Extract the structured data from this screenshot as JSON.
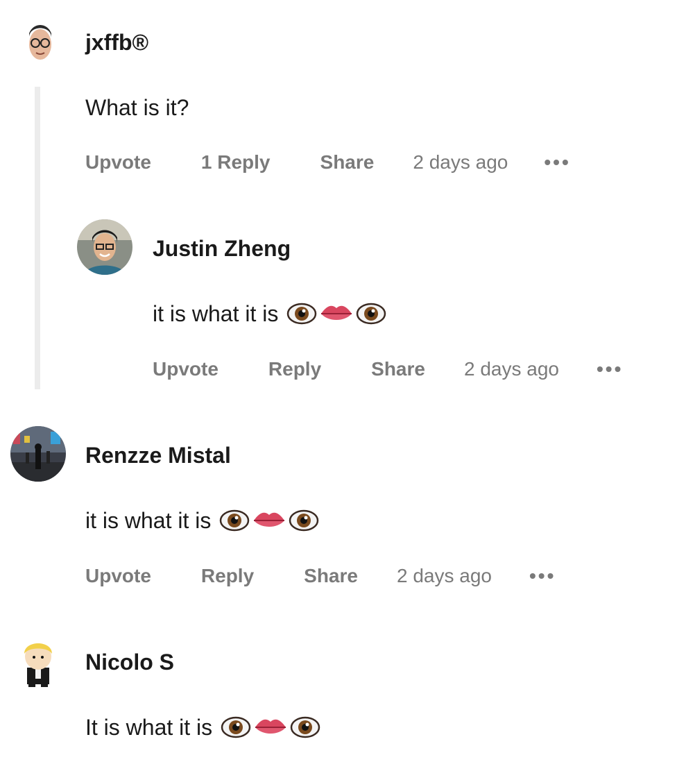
{
  "comments": [
    {
      "author": "jxffb®",
      "text": "What is it?",
      "actions": {
        "upvote": "Upvote",
        "reply": "1 Reply",
        "share": "Share",
        "time": "2 days ago",
        "more": "•••"
      },
      "emojis": []
    },
    {
      "author": "Justin Zheng",
      "text": "it is what it is",
      "actions": {
        "upvote": "Upvote",
        "reply": "Reply",
        "share": "Share",
        "time": "2 days ago",
        "more": "•••"
      },
      "emojis": [
        "eye-emoji",
        "lips-emoji",
        "eye-emoji"
      ]
    },
    {
      "author": "Renzze Mistal",
      "text": "it is what it is",
      "actions": {
        "upvote": "Upvote",
        "reply": "Reply",
        "share": "Share",
        "time": "2 days ago",
        "more": "•••"
      },
      "emojis": [
        "eye-emoji",
        "lips-emoji",
        "eye-emoji"
      ]
    },
    {
      "author": "Nicolo S",
      "text": "It is what it is",
      "emojis": [
        "eye-emoji",
        "lips-emoji",
        "eye-emoji"
      ]
    }
  ],
  "colors": {
    "text": "#1a1a1a",
    "muted": "#7a7a7a",
    "thread_line": "#ececec"
  }
}
